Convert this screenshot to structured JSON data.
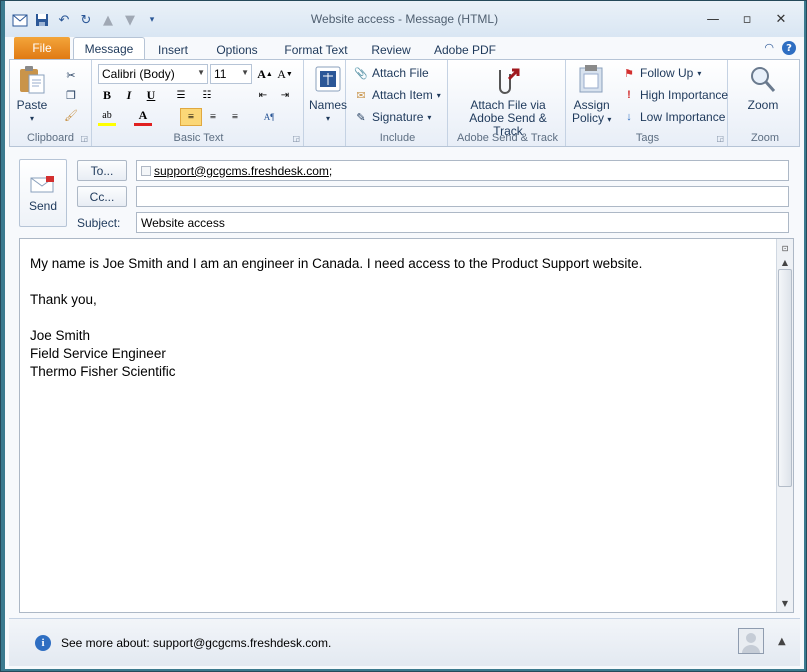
{
  "window": {
    "title": "Website access  -  Message (HTML)"
  },
  "quick_access": {
    "icons": [
      "outlook-icon",
      "save-icon",
      "undo-icon",
      "redo-icon",
      "up-arrow-icon",
      "down-arrow-icon",
      "customize-icon"
    ]
  },
  "tabs": [
    {
      "label": "File"
    },
    {
      "label": "Message"
    },
    {
      "label": "Insert"
    },
    {
      "label": "Options"
    },
    {
      "label": "Format Text"
    },
    {
      "label": "Review"
    },
    {
      "label": "Adobe PDF"
    }
  ],
  "ribbon": {
    "clipboard": {
      "label": "Clipboard",
      "paste": "Paste"
    },
    "basic_text": {
      "label": "Basic Text",
      "font": "Calibri (Body)",
      "size": "11"
    },
    "names": {
      "label": "Names"
    },
    "include": {
      "label": "Include",
      "attach_file": "Attach File",
      "attach_item": "Attach Item",
      "signature": "Signature"
    },
    "adobe": {
      "label": "Adobe Send & Track",
      "attach_line1": "Attach File via",
      "attach_line2": "Adobe Send & Track"
    },
    "tags": {
      "label": "Tags",
      "assign_line1": "Assign",
      "assign_line2": "Policy",
      "follow_up": "Follow Up",
      "high": "High Importance",
      "low": "Low Importance"
    },
    "zoom": {
      "label": "Zoom",
      "button": "Zoom"
    }
  },
  "header": {
    "send": "Send",
    "to_button": "To...",
    "cc_button": "Cc...",
    "subject_label": "Subject:",
    "to_value": "support@gcgcms.freshdesk.com",
    "to_sep": ";",
    "cc_value": "",
    "subject_value": "Website access"
  },
  "body": {
    "lines": [
      "My name is Joe Smith and I am an engineer in Canada. I need access to the Product Support website.",
      "",
      "Thank you,",
      "",
      "Joe Smith",
      "Field Service Engineer",
      "Thermo Fisher Scientific"
    ]
  },
  "footer": {
    "see_more": "See more about: support@gcgcms.freshdesk.com."
  },
  "colors": {
    "file_tab": "#e07a14",
    "accent": "#2b5797",
    "frame": "#3b7a8f"
  }
}
